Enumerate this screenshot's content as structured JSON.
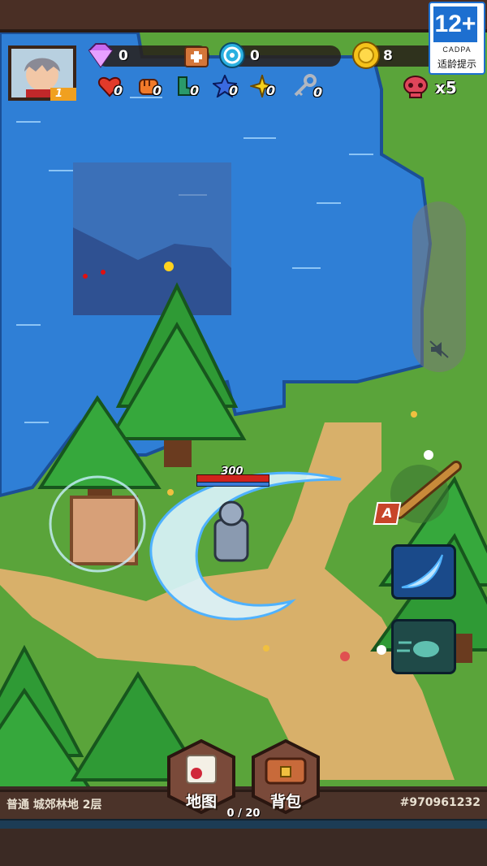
{
  "age_rating": {
    "number": "12+",
    "org": "CADPA",
    "tip": "适龄提示"
  },
  "player": {
    "level": "1"
  },
  "resources": {
    "gems": "0",
    "tokens": "0",
    "coins": "8"
  },
  "items": [
    {
      "icon": "red-heart-icon",
      "count": "0"
    },
    {
      "icon": "fist-icon",
      "count": "0"
    },
    {
      "icon": "boot-icon",
      "count": "0"
    },
    {
      "icon": "blue-star-icon",
      "count": "0"
    },
    {
      "icon": "gold-star-icon",
      "count": "0"
    },
    {
      "icon": "key-icon",
      "count": "0"
    }
  ],
  "enemies_remaining": "x5",
  "hero": {
    "hp": "300"
  },
  "attack_button": {
    "label": "A"
  },
  "menu": {
    "map_label": "地图",
    "bag_label": "背包"
  },
  "status": {
    "floor": "普通 城郊林地 2层",
    "id": "#970961232",
    "progress": "0 / 20"
  },
  "colors": {
    "water": "#2f7fd6",
    "grass": "#5aa43a",
    "path": "#d8b06a",
    "tree": "#2f9a35"
  }
}
